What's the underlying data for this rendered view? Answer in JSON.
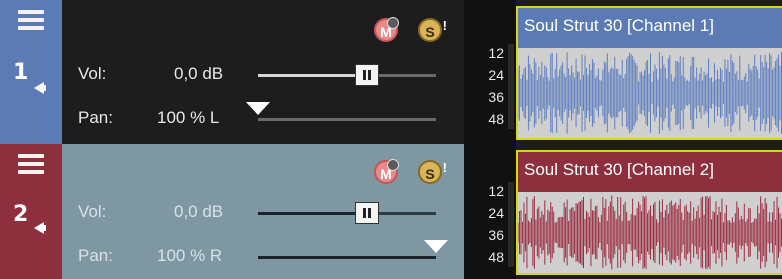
{
  "tracks": [
    {
      "number": "1",
      "color": "#5c7ab4",
      "vol_label": "Vol:",
      "vol_value": "0,0 dB",
      "vol_fraction": 0.61,
      "pan_label": "Pan:",
      "pan_value": "100 % L",
      "pan_fraction": 0.0,
      "meter_ticks": [
        "12",
        "24",
        "36",
        "48"
      ],
      "clip_title": "Soul Strut 30 [Channel 1]",
      "wave_color": "#5e7fc0"
    },
    {
      "number": "2",
      "color": "#8e2f3e",
      "vol_label": "Vol:",
      "vol_value": "0,0 dB",
      "vol_fraction": 0.61,
      "pan_label": "Pan:",
      "pan_value": "100 % R",
      "pan_fraction": 1.0,
      "meter_ticks": [
        "12",
        "24",
        "36",
        "48"
      ],
      "clip_title": "Soul Strut 30 [Channel 2]",
      "wave_color": "#9a2c40"
    }
  ],
  "icons": {
    "menu": "menu-icon",
    "mute": "mute-icon",
    "solo": "solo-icon",
    "speaker": "speaker-icon"
  },
  "icon_glyphs": {
    "mute": "M",
    "solo": "S"
  }
}
